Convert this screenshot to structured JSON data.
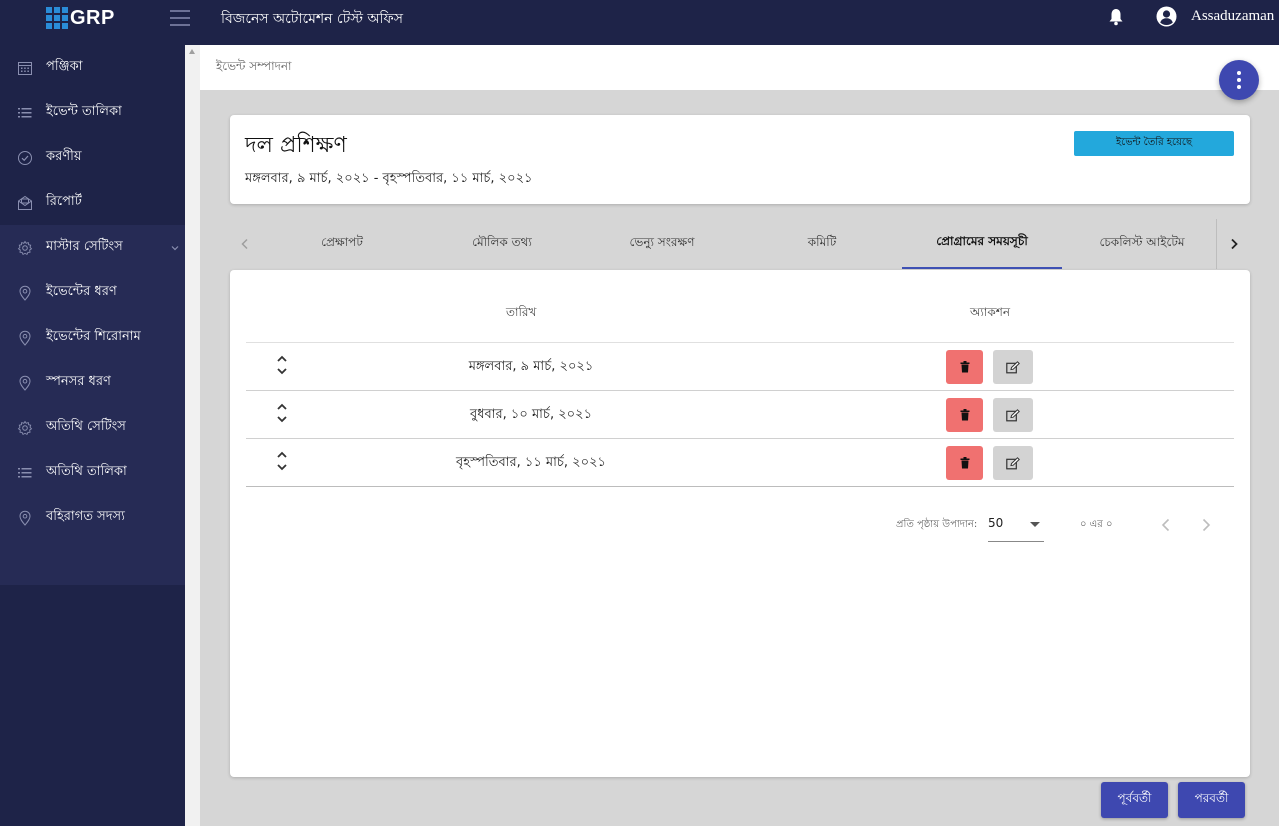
{
  "app": {
    "logo_text": "GRP",
    "title": "বিজনেস অটোমেশন টেস্ট অফিস",
    "user_name": "Assaduzaman"
  },
  "sidebar": {
    "items": [
      {
        "label": "পঞ্জিকা",
        "icon": "calendar-icon"
      },
      {
        "label": "ইভেন্ট তালিকা",
        "icon": "list-icon"
      },
      {
        "label": "করণীয়",
        "icon": "check-circle-icon"
      },
      {
        "label": "রিপোর্ট",
        "icon": "report-icon"
      },
      {
        "label": "মাস্টার সেটিংস",
        "icon": "gear-icon"
      },
      {
        "label": "ইভেন্টের ধরণ",
        "icon": "location-pin-icon"
      },
      {
        "label": "ইভেন্টের শিরোনাম",
        "icon": "location-pin-icon"
      },
      {
        "label": "স্পনসর ধরণ",
        "icon": "location-pin-icon"
      },
      {
        "label": "অতিথি সেটিংস",
        "icon": "gear-icon"
      },
      {
        "label": "অতিথি তালিকা",
        "icon": "list-icon"
      },
      {
        "label": "বহিরাগত সদস্য",
        "icon": "location-pin-icon"
      }
    ]
  },
  "breadcrumb": "ইভেন্ট সম্পাদনা",
  "event": {
    "title": "দল প্রশিক্ষণ",
    "dates": "মঙ্গলবার, ৯ মার্চ, ২০২১ - বৃহস্পতিবার, ১১ মার্চ, ২০২১",
    "status_label": "ইভেন্ট তৈরি হয়েছে",
    "status_color": "#23a8dc"
  },
  "tabs": [
    {
      "label": "প্রেক্ষাপট"
    },
    {
      "label": "মৌলিক তথ্য"
    },
    {
      "label": "ভেন্যু সংরক্ষণ"
    },
    {
      "label": "কমিটি"
    },
    {
      "label": "প্রোগ্রামের সময়সূচী",
      "active": true
    },
    {
      "label": "চেকলিস্ট আইটেম"
    }
  ],
  "table": {
    "headers": {
      "date": "তারিখ",
      "action": "অ্যাকশন"
    },
    "rows": [
      {
        "date": "মঙ্গলবার, ৯ মার্চ, ২০২১"
      },
      {
        "date": "বুধবার, ১০ মার্চ, ২০২১"
      },
      {
        "date": "বৃহস্পতিবার, ১১ মার্চ, ২০২১"
      }
    ]
  },
  "paginator": {
    "label": "প্রতি পৃষ্ঠায় উপাদান:",
    "page_size": "50",
    "range": "০ এর ০"
  },
  "footer": {
    "prev_label": "পূর্ববর্তী",
    "next_label": "পরবর্তী"
  },
  "colors": {
    "sidebar_bg": "#1e2348",
    "accent": "#3e48b0",
    "delete": "#f07170"
  }
}
